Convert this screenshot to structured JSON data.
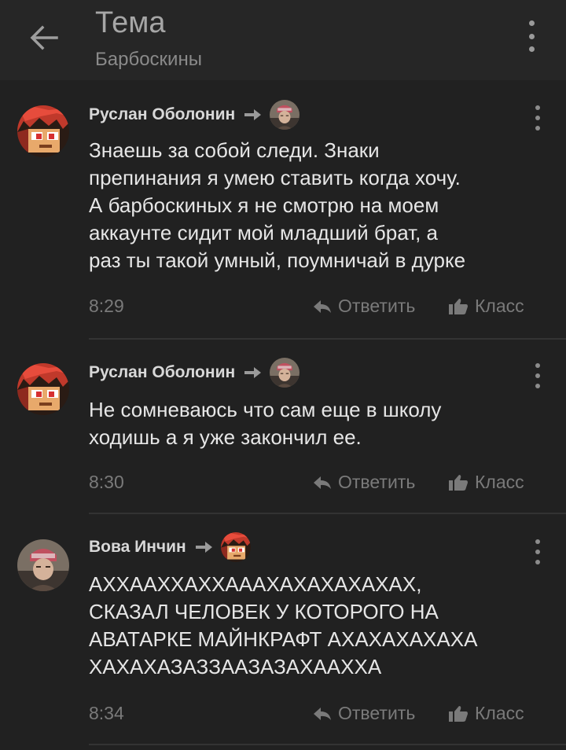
{
  "header": {
    "title": "Тема",
    "subtitle": "Барбоскины"
  },
  "comments": [
    {
      "author": "Руслан Оболонин",
      "text": "Знаешь за собой следи. Знаки\nпрепинания я умею ставить когда хочу.\nА барбоскиных я не смотрю на моем\nаккаунте сидит мой младший брат, а\nраз ты такой умный, поумничай в дурке",
      "time": "8:29",
      "reply_label": "Ответить",
      "like_label": "Класс"
    },
    {
      "author": "Руслан Оболонин",
      "text": "Не сомневаюсь что сам еще в школу\nходишь а я уже закончил ее.",
      "time": "8:30",
      "reply_label": "Ответить",
      "like_label": "Класс"
    },
    {
      "author": "Вова Инчин",
      "text": "АХХААХХАХХАААХАХАХАХАХАХ,\nСКАЗАЛ ЧЕЛОВЕК У КОТОРОГО НА\nАВАТАРКЕ МАЙНКРАФТ АХАХАХАХАХА\nХАХАХАЗАЗЗААЗАЗАХААХХА",
      "time": "8:34",
      "reply_label": "Ответить",
      "like_label": "Класс"
    }
  ],
  "icons": {
    "back": "arrow-left-icon",
    "menu": "more-vertical-icon",
    "reply": "reply-icon",
    "like": "thumbs-up-icon",
    "reply_to": "arrow-right-icon"
  },
  "colors": {
    "background": "#212121",
    "header": "#262626",
    "text": "#e6e6e6",
    "muted": "#7a7a7a"
  }
}
